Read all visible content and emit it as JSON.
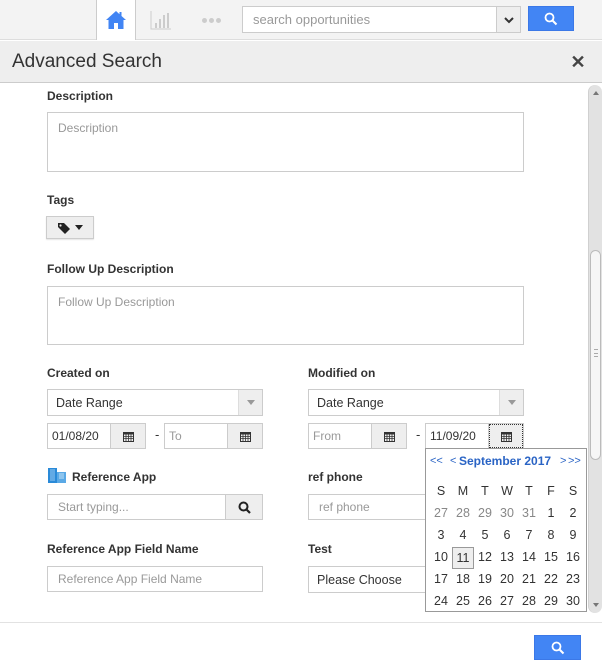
{
  "topnav": {
    "search_placeholder": "search opportunities",
    "accent_color": "#4285f4"
  },
  "dialog": {
    "title": "Advanced Search",
    "close_icon": "close-icon"
  },
  "form": {
    "description": {
      "label": "Description",
      "placeholder": "Description"
    },
    "tags": {
      "label": "Tags"
    },
    "follow_up": {
      "label": "Follow Up Description",
      "placeholder": "Follow Up Description"
    },
    "created_on": {
      "label": "Created on",
      "mode": "Date Range",
      "from_value": "01/08/20",
      "to_placeholder": "To",
      "separator": "-"
    },
    "modified_on": {
      "label": "Modified on",
      "mode": "Date Range",
      "from_placeholder": "From",
      "to_value": "11/09/20",
      "separator": "-"
    },
    "reference_app": {
      "label": "Reference App",
      "placeholder": "Start typing..."
    },
    "ref_phone": {
      "label": "ref phone",
      "placeholder": "ref phone"
    },
    "reference_app_field": {
      "label": "Reference App Field Name",
      "placeholder": "Reference App Field Name"
    },
    "test": {
      "label": "Test",
      "value": "Please Choose"
    }
  },
  "calendar": {
    "prev_year": "<<",
    "prev_month": "<",
    "month_label": "September 2017",
    "next_month": ">",
    "next_year": ">>",
    "weekdays": [
      "S",
      "M",
      "T",
      "W",
      "T",
      "F",
      "S"
    ],
    "weeks": [
      [
        "27",
        "28",
        "29",
        "30",
        "31",
        "1",
        "2"
      ],
      [
        "3",
        "4",
        "5",
        "6",
        "7",
        "8",
        "9"
      ],
      [
        "10",
        "11",
        "12",
        "13",
        "14",
        "15",
        "16"
      ],
      [
        "17",
        "18",
        "19",
        "20",
        "21",
        "22",
        "23"
      ],
      [
        "24",
        "25",
        "26",
        "27",
        "28",
        "29",
        "30"
      ]
    ],
    "muted_days_first_row": 5,
    "selected_day": "11"
  },
  "scroll": {
    "position_fraction": 0.52
  }
}
